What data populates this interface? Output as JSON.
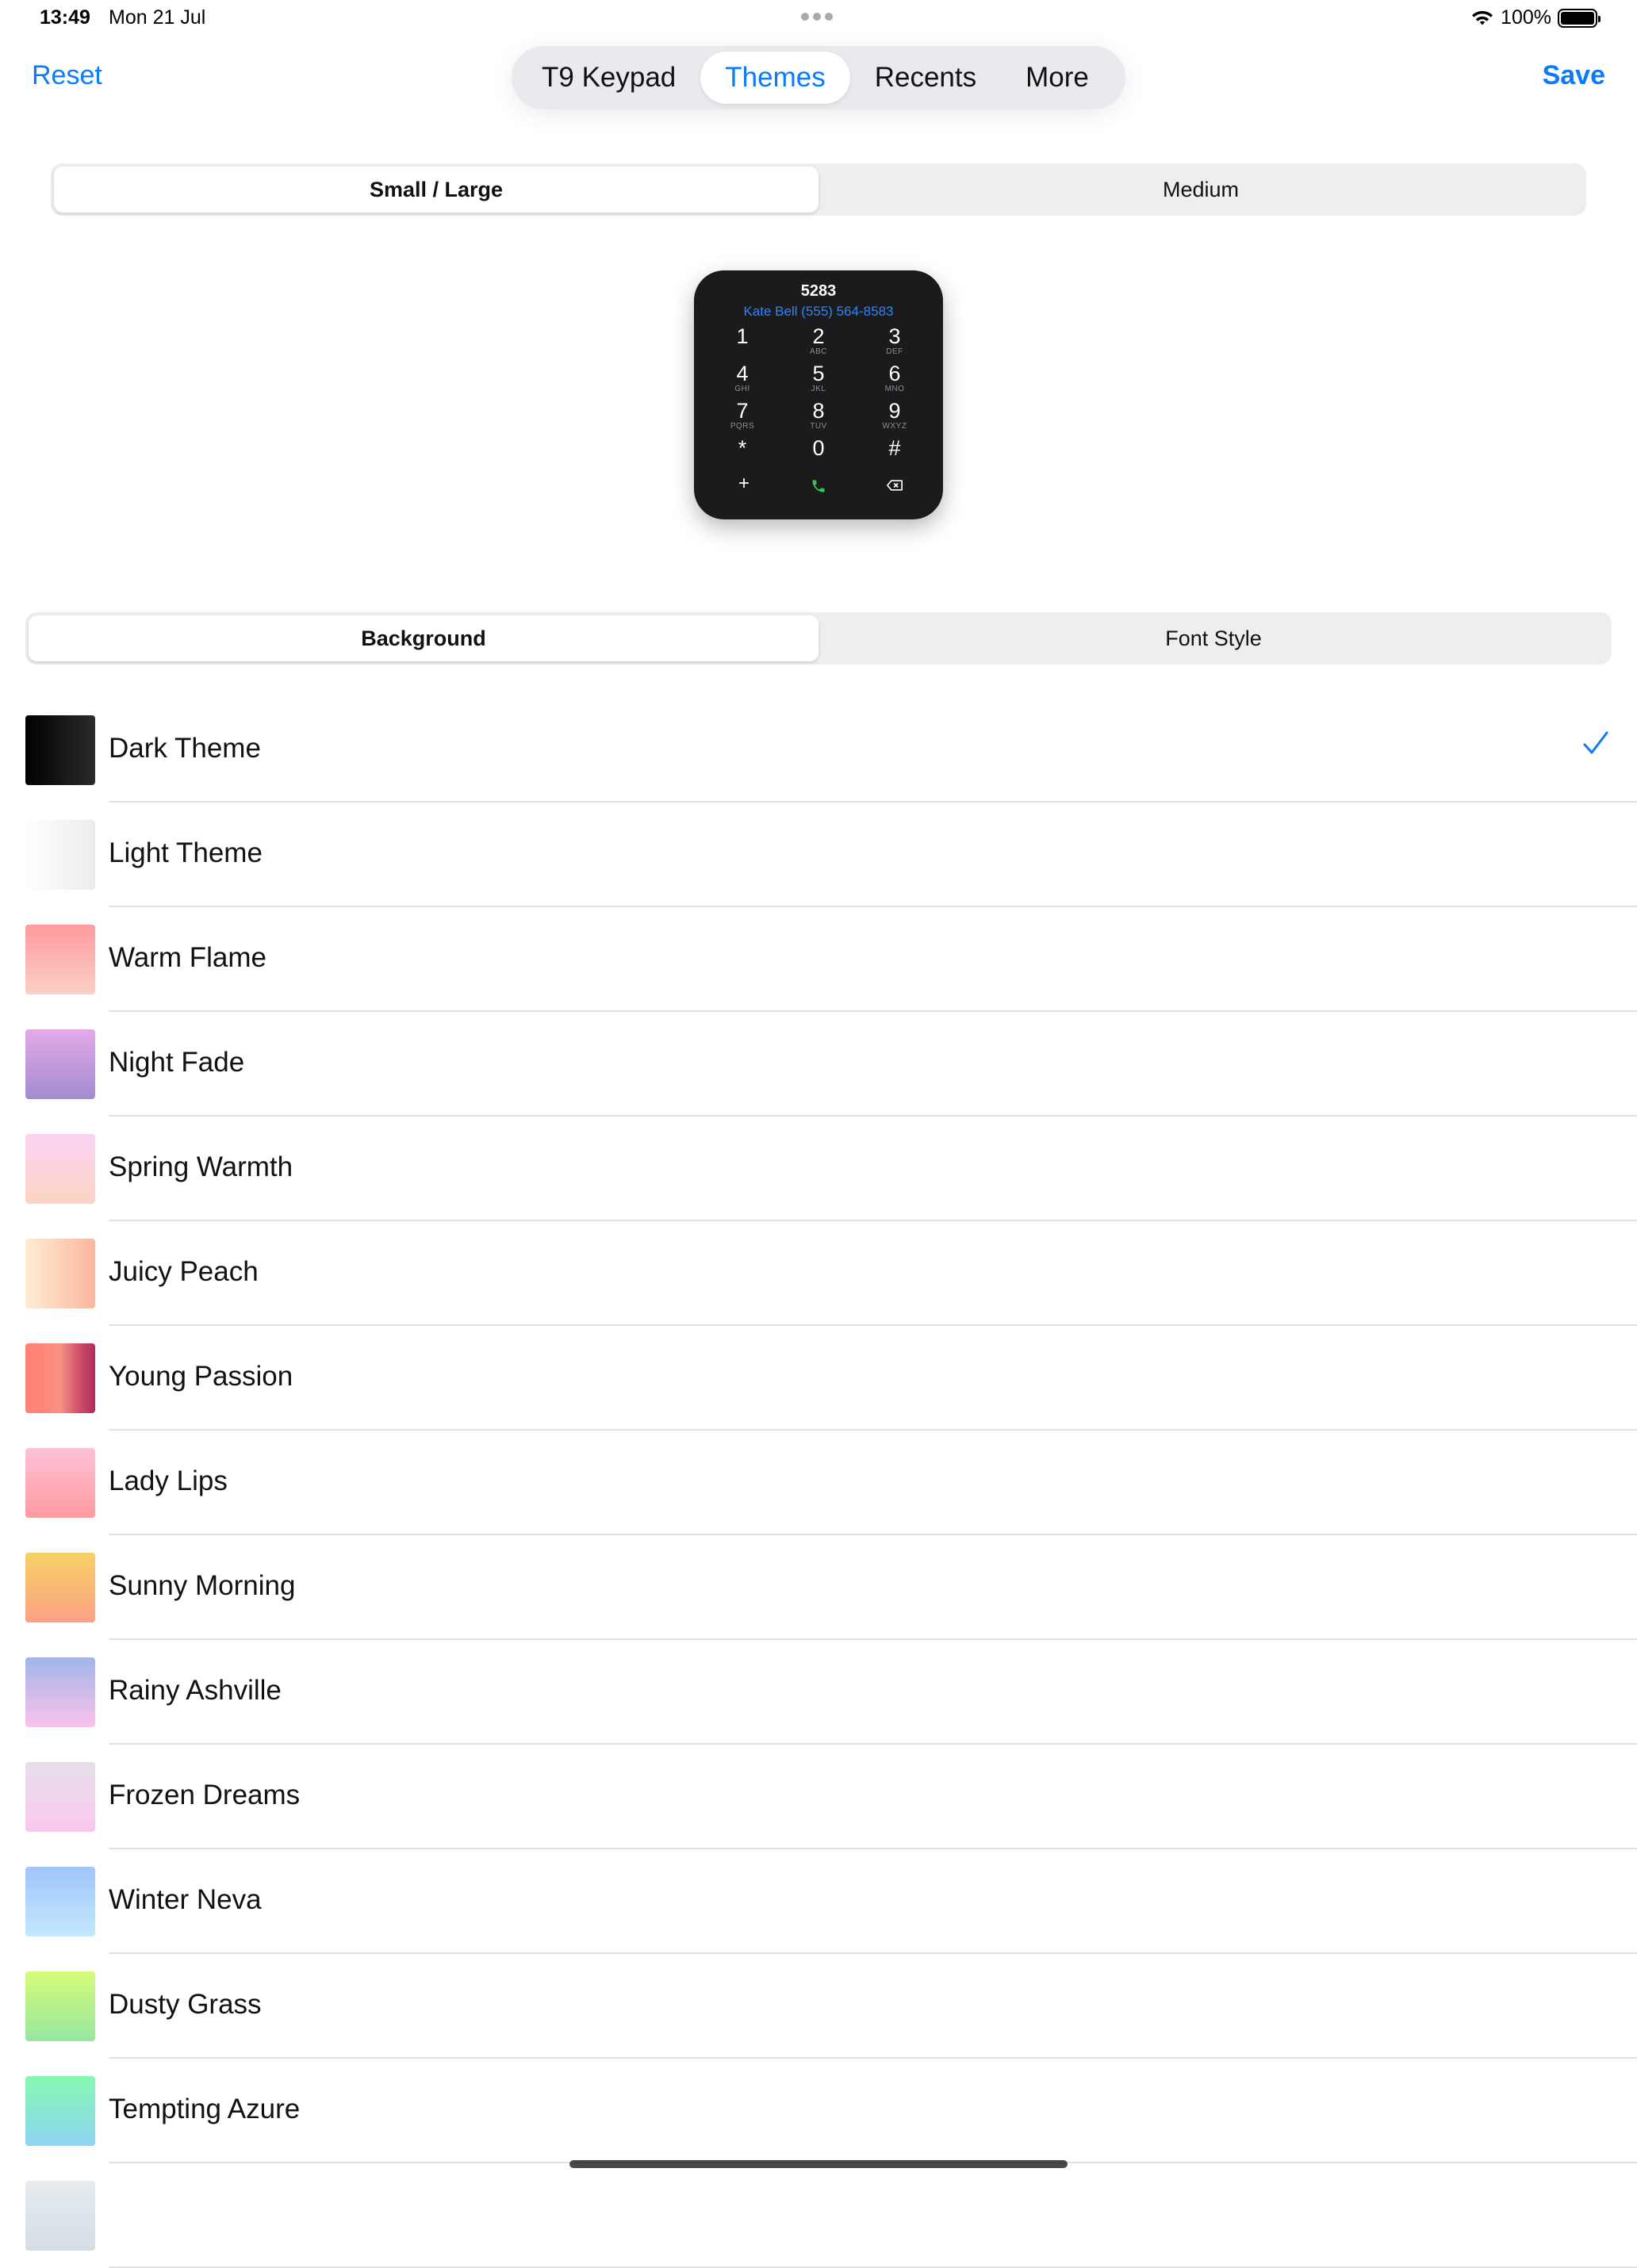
{
  "status_bar": {
    "time": "13:49",
    "date": "Mon 21 Jul",
    "battery": "100%"
  },
  "nav": {
    "reset_label": "Reset",
    "save_label": "Save",
    "tabs": [
      {
        "label": "T9 Keypad",
        "active": false
      },
      {
        "label": "Themes",
        "active": true
      },
      {
        "label": "Recents",
        "active": false
      },
      {
        "label": "More",
        "active": false
      }
    ]
  },
  "size_segment": {
    "options": [
      "Small / Large",
      "Medium"
    ],
    "selected": "Small / Large"
  },
  "widget_preview": {
    "number": "5283",
    "contact": "Kate Bell (555) 564-8583",
    "keys": [
      {
        "digit": "1",
        "letters": ""
      },
      {
        "digit": "2",
        "letters": "ABC"
      },
      {
        "digit": "3",
        "letters": "DEF"
      },
      {
        "digit": "4",
        "letters": "GHI"
      },
      {
        "digit": "5",
        "letters": "JKL"
      },
      {
        "digit": "6",
        "letters": "MNO"
      },
      {
        "digit": "7",
        "letters": "PQRS"
      },
      {
        "digit": "8",
        "letters": "TUV"
      },
      {
        "digit": "9",
        "letters": "WXYZ"
      },
      {
        "digit": "*",
        "letters": ""
      },
      {
        "digit": "0",
        "letters": ""
      },
      {
        "digit": "#",
        "letters": ""
      }
    ],
    "actions": {
      "add": "+",
      "call_icon": "phone-icon",
      "delete_icon": "backspace-icon"
    }
  },
  "settings_segment": {
    "options": [
      "Background",
      "Font Style"
    ],
    "selected": "Background"
  },
  "themes": [
    {
      "name": "Dark Theme",
      "selected": true,
      "colors": [
        "#000000",
        "#2b2b2b"
      ],
      "direction": "to right"
    },
    {
      "name": "Light Theme",
      "selected": false,
      "colors": [
        "#ffffff",
        "#ececec"
      ],
      "direction": "to right"
    },
    {
      "name": "Warm Flame",
      "selected": false,
      "colors": [
        "#ff9a9e",
        "#fad0c4"
      ],
      "direction": "to bottom"
    },
    {
      "name": "Night Fade",
      "selected": false,
      "colors": [
        "#e5a9e8",
        "#a18cd1"
      ],
      "direction": "to bottom"
    },
    {
      "name": "Spring Warmth",
      "selected": false,
      "colors": [
        "#fbd3f3",
        "#fcd3c4"
      ],
      "direction": "to bottom"
    },
    {
      "name": "Juicy Peach",
      "selected": false,
      "colors": [
        "#ffecd2",
        "#fcb69f"
      ],
      "direction": "to right"
    },
    {
      "name": "Young Passion",
      "selected": false,
      "colors": [
        "#ff8177",
        "#ff867a",
        "#f99185",
        "#cf556c",
        "#b12a5b"
      ],
      "direction": "to right"
    },
    {
      "name": "Lady Lips",
      "selected": false,
      "colors": [
        "#ffc3d8",
        "#ff9a9e"
      ],
      "direction": "to bottom"
    },
    {
      "name": "Sunny Morning",
      "selected": false,
      "colors": [
        "#f6d365",
        "#fda085"
      ],
      "direction": "to bottom"
    },
    {
      "name": "Rainy Ashville",
      "selected": false,
      "colors": [
        "#a1b5ea",
        "#fbc2eb"
      ],
      "direction": "to bottom"
    },
    {
      "name": "Frozen Dreams",
      "selected": false,
      "colors": [
        "#e6dee9",
        "#fbc8ee"
      ],
      "direction": "to bottom"
    },
    {
      "name": "Winter Neva",
      "selected": false,
      "colors": [
        "#a1c4fd",
        "#c2e9fb"
      ],
      "direction": "to bottom"
    },
    {
      "name": "Dusty Grass",
      "selected": false,
      "colors": [
        "#d4fc79",
        "#96e6a1"
      ],
      "direction": "to bottom"
    },
    {
      "name": "Tempting Azure",
      "selected": false,
      "colors": [
        "#84fab0",
        "#8fd3f4"
      ],
      "direction": "to bottom"
    },
    {
      "name": "",
      "selected": false,
      "colors": [
        "#e6ecf0",
        "#d5dde3"
      ],
      "direction": "to bottom"
    }
  ],
  "accent_color": "#0a7aff"
}
